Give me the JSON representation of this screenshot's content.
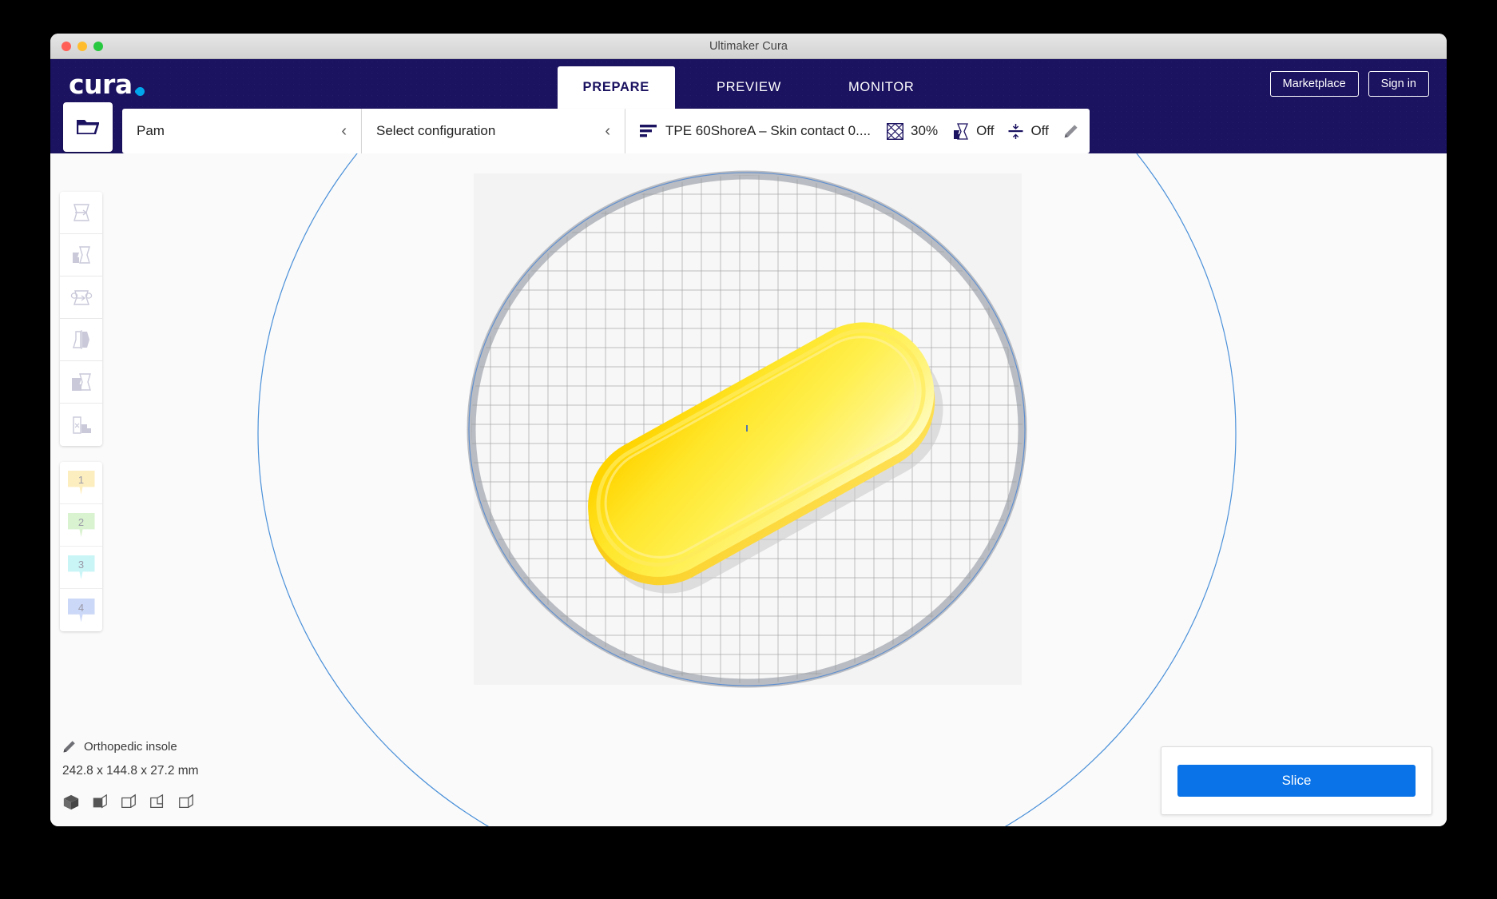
{
  "window": {
    "title": "Ultimaker Cura",
    "traffic_lights": [
      "close",
      "minimize",
      "maximize"
    ]
  },
  "header": {
    "logo_text": "cura",
    "logo_dot_color": "#00a6eb",
    "background_color": "#1b1260",
    "tabs": [
      {
        "label": "PREPARE",
        "active": true
      },
      {
        "label": "PREVIEW",
        "active": false
      },
      {
        "label": "MONITOR",
        "active": false
      }
    ],
    "marketplace_label": "Marketplace",
    "signin_label": "Sign in"
  },
  "config_bar": {
    "open_file_icon": "folder-open-icon",
    "printer_name": "Pam",
    "printer_chevron": "chevron-left-icon",
    "configuration_label": "Select configuration",
    "configuration_chevron": "chevron-left-icon",
    "material_icon": "layers-icon",
    "material_name": "TPE 60ShoreA – Skin contact 0....",
    "settings": [
      {
        "icon": "infill-icon",
        "value": "30%"
      },
      {
        "icon": "support-icon",
        "value": "Off"
      },
      {
        "icon": "adhesion-icon",
        "value": "Off"
      }
    ],
    "edit_icon": "pencil-icon"
  },
  "toolbar": {
    "tools": [
      {
        "name": "move-tool",
        "label": "Move"
      },
      {
        "name": "scale-tool",
        "label": "Scale"
      },
      {
        "name": "rotate-tool",
        "label": "Rotate"
      },
      {
        "name": "mirror-tool",
        "label": "Mirror"
      },
      {
        "name": "per-model-settings-tool",
        "label": "Per Model Settings"
      },
      {
        "name": "support-blocker-tool",
        "label": "Support Blocker"
      }
    ],
    "extruders": [
      {
        "number": "1",
        "color": "#fdeec0"
      },
      {
        "number": "2",
        "color": "#d9f2cf"
      },
      {
        "number": "3",
        "color": "#c9f5f7"
      },
      {
        "number": "4",
        "color": "#ccd8f7"
      }
    ]
  },
  "object_info": {
    "pencil_icon": "pencil-icon",
    "name": "Orthopedic insole",
    "dimensions": "242.8 x 144.8 x 27.2 mm",
    "view_icons": [
      "solid-view-icon",
      "xray-view-icon",
      "layer-view-icon",
      "compatibility-view-icon",
      "wireframe-view-icon"
    ]
  },
  "slice_panel": {
    "button_label": "Slice",
    "button_color": "#0a73e8"
  },
  "scene": {
    "build_plate_shape": "circular",
    "model_color": "#ffe42d",
    "disallowed_area_color": "#4a90d9",
    "grid_color": "#9a9a9a"
  }
}
